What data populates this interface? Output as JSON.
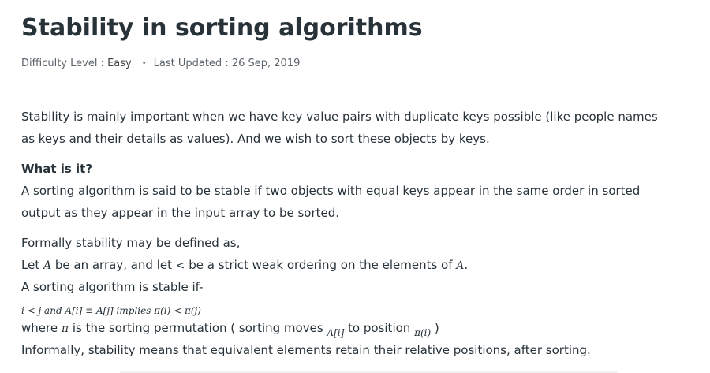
{
  "article": {
    "title": "Stability in sorting algorithms",
    "meta": {
      "difficulty_label": "Difficulty Level : ",
      "difficulty_value": "Easy",
      "separator": "•",
      "updated_label": "Last Updated : ",
      "updated_value": "26 Sep, 2019"
    },
    "paragraphs": {
      "intro_1": "Stability is mainly important when we have key value pairs with duplicate keys possible (like people names",
      "intro_2": "as keys and their details as values). And we wish to sort these objects by keys.",
      "heading": "What is it?",
      "def_1": "A sorting algorithm is said to be stable if two objects with equal keys appear in the same order in sorted",
      "def_2": "output as they appear in the input array to be sorted.",
      "formal_1": "Formally stability may be defined as,",
      "formal_2a": "Let ",
      "formal_2_var_a": "A",
      "formal_2b": " be an array, and let ",
      "formal_2_lt": "<",
      "formal_2c": " be a strict weak ordering on the elements of ",
      "formal_2_var_a2": "A",
      "formal_2d": ".",
      "formal_3": "A sorting algorithm is stable if-",
      "formula": "i < j  and  A[i] ≡ A[j]  implies  π(i) < π(j)",
      "where_a": "where ",
      "where_pi": "π",
      "where_b": " is the sorting permutation ( sorting moves ",
      "where_ai": "A[i]",
      "where_c": " to position ",
      "where_pii": "π(i)",
      "where_d": " )",
      "informal": "Informally, stability means that equivalent elements retain their relative positions, after sorting."
    }
  }
}
